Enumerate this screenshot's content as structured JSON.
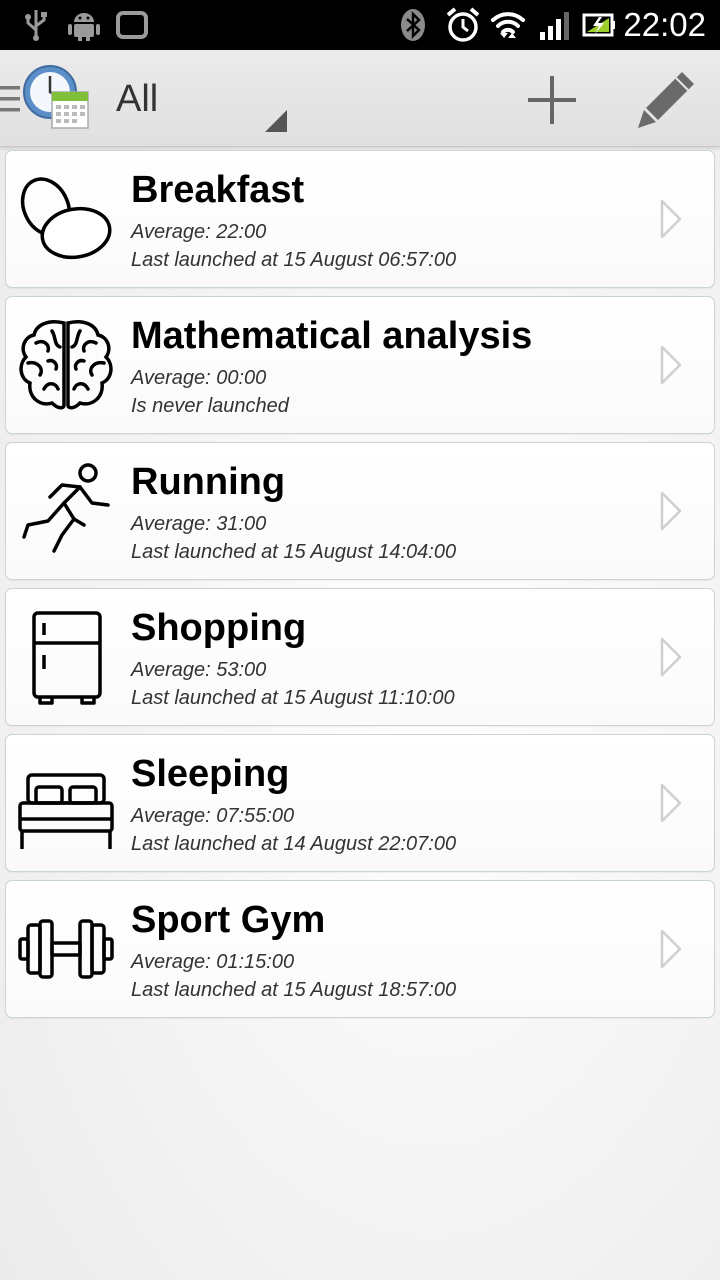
{
  "status_bar": {
    "time": "22:02",
    "icons": [
      "usb-icon",
      "android-icon",
      "screen-icon",
      "bluetooth-icon",
      "alarm-icon",
      "wifi-icon",
      "signal-icon",
      "battery-icon"
    ]
  },
  "action_bar": {
    "filter_label": "All",
    "icons": [
      "menu-icon",
      "app-logo-icon",
      "add-icon",
      "edit-icon"
    ]
  },
  "activities": [
    {
      "title": "Breakfast",
      "average": "Average: 22:00",
      "last": "Last launched at 15 August 06:57:00",
      "icon": "eggs-icon"
    },
    {
      "title": "Mathematical analysis",
      "average": "Average: 00:00",
      "last": "Is never launched",
      "icon": "brain-icon"
    },
    {
      "title": "Running",
      "average": "Average: 31:00",
      "last": "Last launched at 15 August 14:04:00",
      "icon": "runner-icon"
    },
    {
      "title": "Shopping",
      "average": "Average: 53:00",
      "last": "Last launched at 15 August 11:10:00",
      "icon": "fridge-icon"
    },
    {
      "title": "Sleeping",
      "average": "Average: 07:55:00",
      "last": "Last launched at 14 August 22:07:00",
      "icon": "bed-icon"
    },
    {
      "title": "Sport Gym",
      "average": "Average: 01:15:00",
      "last": "Last launched at 15 August 18:57:00",
      "icon": "dumbbell-icon"
    }
  ]
}
